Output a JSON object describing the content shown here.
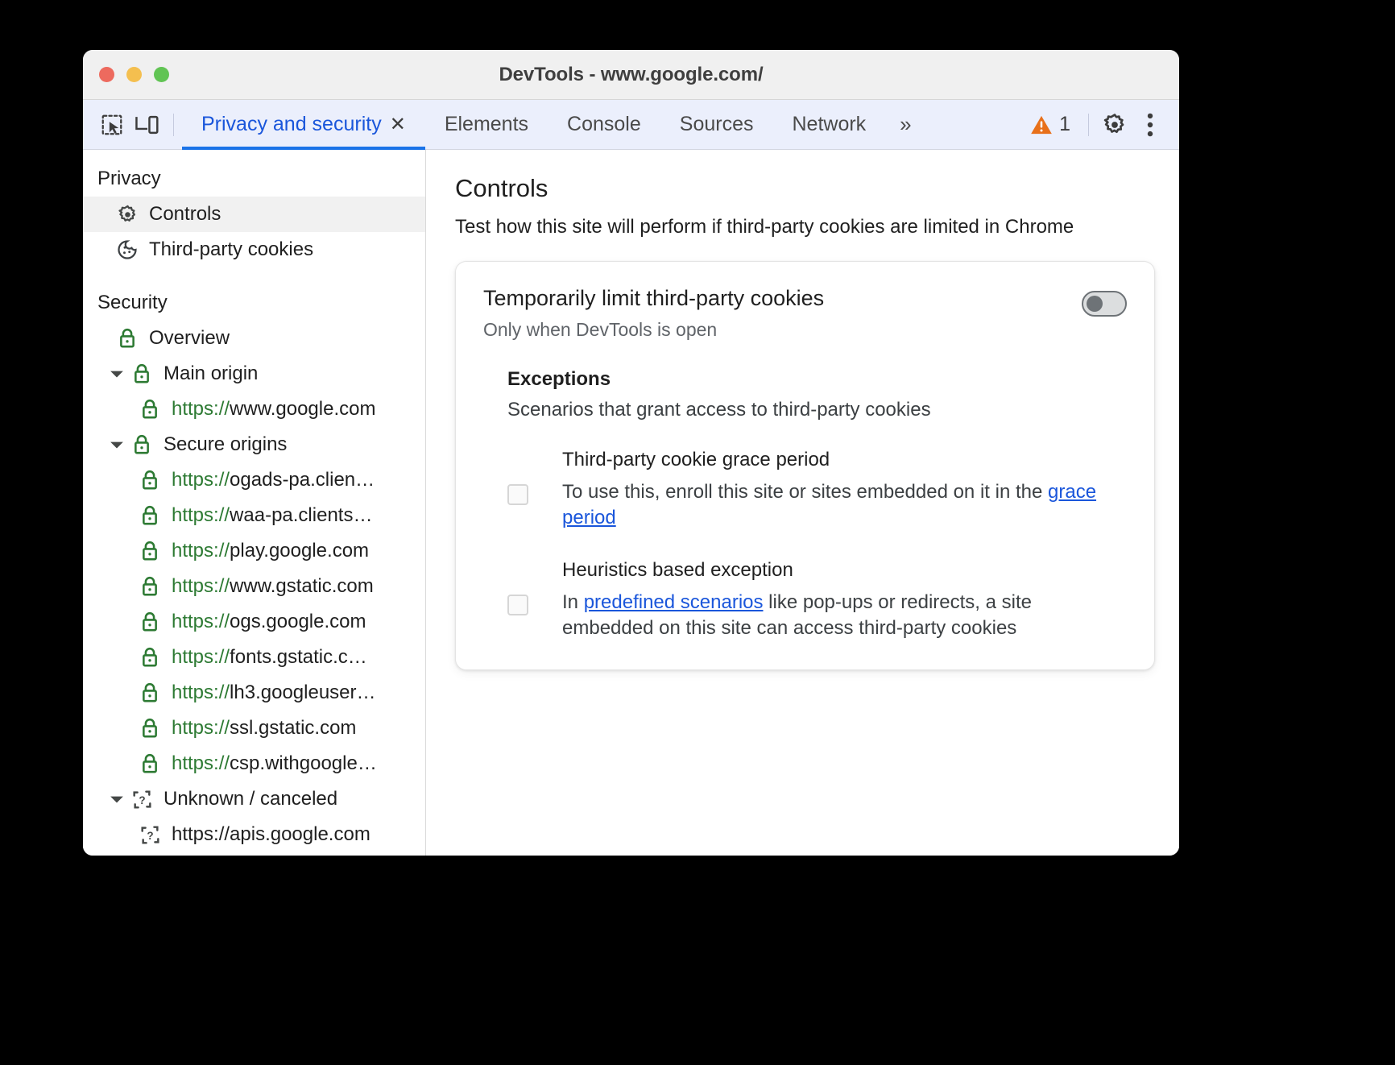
{
  "window": {
    "title": "DevTools - www.google.com/",
    "traffic_lights": [
      "close",
      "minimize",
      "zoom"
    ]
  },
  "toolbar": {
    "inspect_icon": "inspect-element-icon",
    "device_icon": "device-toolbar-icon",
    "tabs": [
      {
        "label": "Privacy and security",
        "active": true,
        "closable": true
      },
      {
        "label": "Elements",
        "active": false,
        "closable": false
      },
      {
        "label": "Console",
        "active": false,
        "closable": false
      },
      {
        "label": "Sources",
        "active": false,
        "closable": false
      },
      {
        "label": "Network",
        "active": false,
        "closable": false
      }
    ],
    "more_tabs_label": "»",
    "warning_count": "1",
    "warning_color": "#e8701a",
    "settings_icon": "gear-icon",
    "more_icon": "three-dot-menu-icon"
  },
  "sidebar": {
    "sections": [
      {
        "title": "Privacy",
        "items": [
          {
            "label": "Controls",
            "icon": "gear-icon",
            "level": 1,
            "selected": true,
            "twisty": "none"
          },
          {
            "label": "Third-party cookies",
            "icon": "cookie-icon",
            "level": 1,
            "selected": false,
            "twisty": "none"
          }
        ]
      },
      {
        "title": "Security",
        "items": [
          {
            "label": "Overview",
            "icon": "lock-green-icon",
            "level": 1,
            "selected": false,
            "twisty": "none"
          },
          {
            "label": "Main origin",
            "icon": "lock-green-icon",
            "level": 0,
            "selected": false,
            "twisty": "expanded"
          },
          {
            "scheme": "https://",
            "host": "www.google.com",
            "icon": "lock-green-icon",
            "level": 2,
            "selected": false,
            "twisty": "none"
          },
          {
            "label": "Secure origins",
            "icon": "lock-green-icon",
            "level": 0,
            "selected": false,
            "twisty": "expanded"
          },
          {
            "scheme": "https://",
            "host": "ogads-pa.clien…",
            "icon": "lock-green-icon",
            "level": 2,
            "selected": false,
            "twisty": "none"
          },
          {
            "scheme": "https://",
            "host": "waa-pa.clients…",
            "icon": "lock-green-icon",
            "level": 2,
            "selected": false,
            "twisty": "none"
          },
          {
            "scheme": "https://",
            "host": "play.google.com",
            "icon": "lock-green-icon",
            "level": 2,
            "selected": false,
            "twisty": "none"
          },
          {
            "scheme": "https://",
            "host": "www.gstatic.com",
            "icon": "lock-green-icon",
            "level": 2,
            "selected": false,
            "twisty": "none"
          },
          {
            "scheme": "https://",
            "host": "ogs.google.com",
            "icon": "lock-green-icon",
            "level": 2,
            "selected": false,
            "twisty": "none"
          },
          {
            "scheme": "https://",
            "host": "fonts.gstatic.c…",
            "icon": "lock-green-icon",
            "level": 2,
            "selected": false,
            "twisty": "none"
          },
          {
            "scheme": "https://",
            "host": "lh3.googleuser…",
            "icon": "lock-green-icon",
            "level": 2,
            "selected": false,
            "twisty": "none"
          },
          {
            "scheme": "https://",
            "host": "ssl.gstatic.com",
            "icon": "lock-green-icon",
            "level": 2,
            "selected": false,
            "twisty": "none"
          },
          {
            "scheme": "https://",
            "host": "csp.withgoogle…",
            "icon": "lock-green-icon",
            "level": 2,
            "selected": false,
            "twisty": "none"
          },
          {
            "label": "Unknown / canceled",
            "icon": "unknown-icon",
            "level": 0,
            "selected": false,
            "twisty": "expanded"
          },
          {
            "label": "https://apis.google.com",
            "icon": "unknown-icon",
            "level": 2,
            "selected": false,
            "twisty": "none"
          }
        ]
      }
    ]
  },
  "main": {
    "title": "Controls",
    "subtitle": "Test how this site will perform if third-party cookies are limited in Chrome",
    "card": {
      "title": "Temporarily limit third-party cookies",
      "subtitle": "Only when DevTools is open",
      "toggle_state": "off",
      "exceptions": {
        "title": "Exceptions",
        "subtitle": "Scenarios that grant access to third-party cookies",
        "items": [
          {
            "name": "Third-party cookie grace period",
            "checked": false,
            "desc_pre": "To use this, enroll this site or sites embedded on it in the ",
            "link": "grace period",
            "desc_post": ""
          },
          {
            "name": "Heuristics based exception",
            "checked": false,
            "desc_pre": "In ",
            "link": "predefined scenarios",
            "desc_post": " like pop-ups or redirects, a site embedded on this site can access third-party cookies"
          }
        ]
      }
    }
  },
  "colors": {
    "accent": "#1a73e8",
    "link": "#1a56db",
    "secure_green": "#2d7a33",
    "warning_orange": "#e8701a",
    "tabbar_bg": "#ebeffc"
  }
}
